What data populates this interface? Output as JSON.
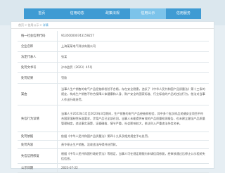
{
  "nav": {
    "items": [
      {
        "label": "首页",
        "active": false
      },
      {
        "label": "信用动态",
        "active": false
      },
      {
        "label": "政策法规",
        "active": false
      },
      {
        "label": "信用公示",
        "active": true
      },
      {
        "label": "信用服务",
        "active": false
      }
    ]
  },
  "breadcrumb": {
    "home": "首页",
    "section": "信用公示",
    "current": "详情"
  },
  "rows": [
    {
      "label": "统一社会信用代码",
      "value": "913500000743159257"
    },
    {
      "label": "企业名称",
      "value": "上海某某电气科技有限公司"
    },
    {
      "label": "法定代表人",
      "value": "张某"
    },
    {
      "label": "处罚文书号",
      "value": "沪市监罚〔2023〕45号"
    },
    {
      "label": "处罚结果",
      "value": "罚款"
    },
    {
      "label": "案由",
      "value": "当事人生产销售的电气产品经抽样检验不合格，存在安全隐患，违反了《中华人民共和国产品质量法》第十三条的规定，构成生产销售不符合保障人体健康和人身、财产安全的国家标准、行业标准的产品的违法行为。依法对当事人作出行政处罚。"
    },
    {
      "label": "失信行为详情",
      "value": "当事人于2022年1月至2023年3月期间，生产销售的电气产品经抽样检验，其中多个批次样品关键安全项目不符合国家强制性标准要求，涉案产品已全部召回。当事人未能提供有效的产品质量检测报告，也未建立健全产品质量管理制度，违法事实清楚，证据确凿，情节严重，社会影响较大，依法列入严重违法失信名单。"
    },
    {
      "label": "处罚依据",
      "value": "依据《中华人民共和国产品质量法》第四十九条及相关规定予以处罚。"
    },
    {
      "label": "处罚内容",
      "value": "责令停止生产销售，没收违法所得并处罚款。"
    },
    {
      "label": "失信信用修复",
      "value": "根据《中华人民共和国行政处罚法》等规定，当事人可在规定期限内申请信用修复，经审核通过后停止公示相关失信信息。"
    },
    {
      "label": "公示日期",
      "value": "2023-07-22"
    }
  ],
  "colors": {
    "nav": "#3f9bd3",
    "nav_active": "#7cc3ea",
    "background": "#e6eef3"
  }
}
